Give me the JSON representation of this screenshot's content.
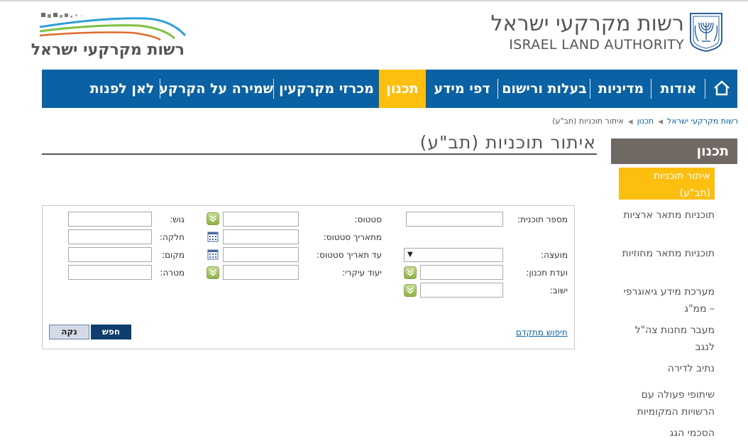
{
  "header": {
    "authority_heb": "רשות מקרקעי ישראל",
    "authority_eng": "ISRAEL LAND AUTHORITY",
    "left_logo_text": "רשות מקרקעי ישראל"
  },
  "nav": {
    "home_icon": "home-icon",
    "items": [
      {
        "label": "אודות"
      },
      {
        "label": "מדיניות"
      },
      {
        "label": "בעלות ורישום"
      },
      {
        "label": "דפי מידע"
      },
      {
        "label": "תכנון"
      },
      {
        "label": "מכרזי מקרקעין"
      },
      {
        "label": "שמירה על הקרקע"
      },
      {
        "label": "לאן לפנות"
      }
    ],
    "active_color": "#fcbf10",
    "bar_color": "#0a61a3"
  },
  "breadcrumb": {
    "items": [
      "רשות מקרקעי ישראל",
      "תכנון",
      "איתור תוכניות (תב\"ע)"
    ]
  },
  "page": {
    "title": "איתור תוכניות (תב\"ע)"
  },
  "sidebar": {
    "heading": "תכנון",
    "items": [
      {
        "label": "איתור תוכניות (תב\"ע)"
      },
      {
        "label": "תוכניות מתאר ארציות"
      },
      {
        "label": "תוכניות מתאר מחוזיות"
      },
      {
        "label": "מערכת מידע גיאוגרפי – ממ\"ג"
      },
      {
        "label": "מעבר מחנות צה\"ל לנגב"
      },
      {
        "label": "נתיב לדירה"
      },
      {
        "label": "שיתופי פעולה עם הרשויות המקומיות"
      },
      {
        "label": "הסכמי הגג"
      }
    ]
  },
  "form": {
    "plan_number_label": "מספר תוכנית:",
    "council_label": "מועצה:",
    "committee_label": "ועדת תכנון:",
    "settlement_label": "ישוב:",
    "status_label": "סטטוס:",
    "status_date_label": "מתאריך סטטוס:",
    "to_status_date_label": "עד תאריך סטטוס:",
    "main_purpose_label": "יעוד עיקרי:",
    "block_label": "גוש:",
    "parcel_label": "חלקה:",
    "place_label": "מקום:",
    "goal_label": "מטרה:",
    "council_value": "",
    "search_button": "חפש",
    "clear_button": "נקה",
    "advanced_search": "חיפוש מתקדם"
  }
}
